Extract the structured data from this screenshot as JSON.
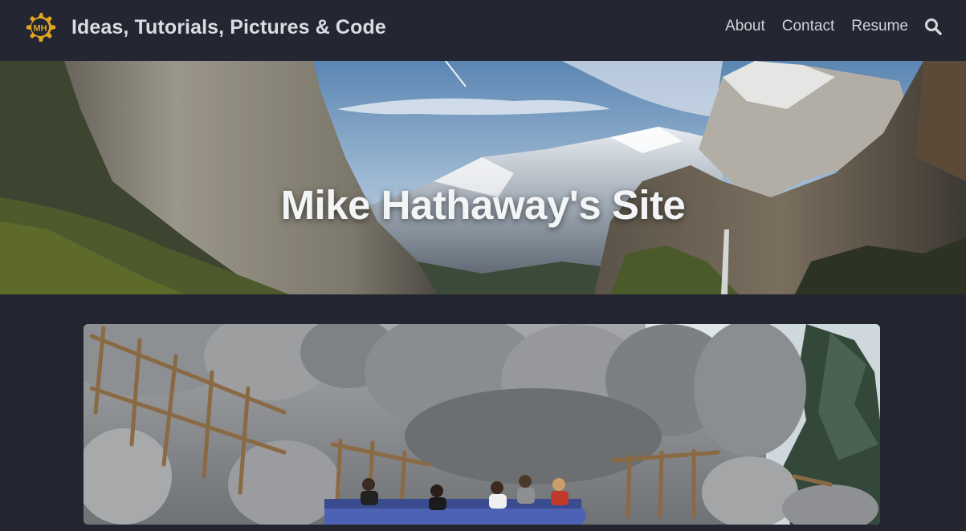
{
  "header": {
    "logo_text": "MH",
    "site_title": "Ideas, Tutorials, Pictures & Code",
    "nav": [
      {
        "label": "About"
      },
      {
        "label": "Contact"
      },
      {
        "label": "Resume"
      }
    ],
    "search_icon": "search-icon"
  },
  "hero": {
    "title": "Mike Hathaway's Site",
    "image": "mountain-valley-landscape"
  },
  "featured": {
    "image": "rollercoaster-rock-canyon"
  },
  "colors": {
    "background": "#232630",
    "navbar": "#242731",
    "logo_gold": "#e0a521",
    "nav_text": "#cfd2d9",
    "title_text": "#d9dce3"
  }
}
